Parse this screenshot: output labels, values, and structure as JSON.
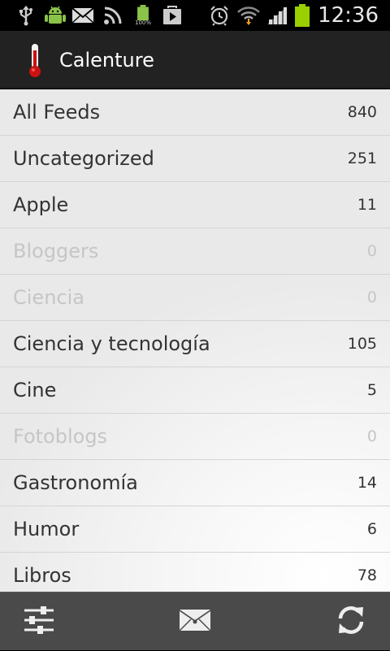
{
  "status_bar": {
    "time": "12:36",
    "battery_indicator_label": "100%",
    "icons": [
      "usb-icon",
      "android-debug-icon",
      "email-icon",
      "rss-icon",
      "battery-full-icon",
      "play-store-icon",
      "alarm-icon",
      "wifi-icon",
      "signal-icon",
      "battery-charging-icon"
    ],
    "battery_color": "#9ad000"
  },
  "action_bar": {
    "title": "Calenture",
    "icon": "thermometer-icon",
    "accent_color": "#cc1111"
  },
  "feeds": [
    {
      "name": "All Feeds",
      "count": "840",
      "empty": false
    },
    {
      "name": "Uncategorized",
      "count": "251",
      "empty": false
    },
    {
      "name": "Apple",
      "count": "11",
      "empty": false
    },
    {
      "name": "Bloggers",
      "count": "0",
      "empty": true
    },
    {
      "name": "Ciencia",
      "count": "0",
      "empty": true
    },
    {
      "name": "Ciencia y tecnología",
      "count": "105",
      "empty": false
    },
    {
      "name": "Cine",
      "count": "5",
      "empty": false
    },
    {
      "name": "Fotoblogs",
      "count": "0",
      "empty": true
    },
    {
      "name": "Gastronomía",
      "count": "14",
      "empty": false
    },
    {
      "name": "Humor",
      "count": "6",
      "empty": false
    },
    {
      "name": "Libros",
      "count": "78",
      "empty": false
    }
  ],
  "bottom_bar": {
    "buttons": [
      "settings-sliders-icon",
      "mark-read-envelope-icon",
      "refresh-icon"
    ]
  }
}
